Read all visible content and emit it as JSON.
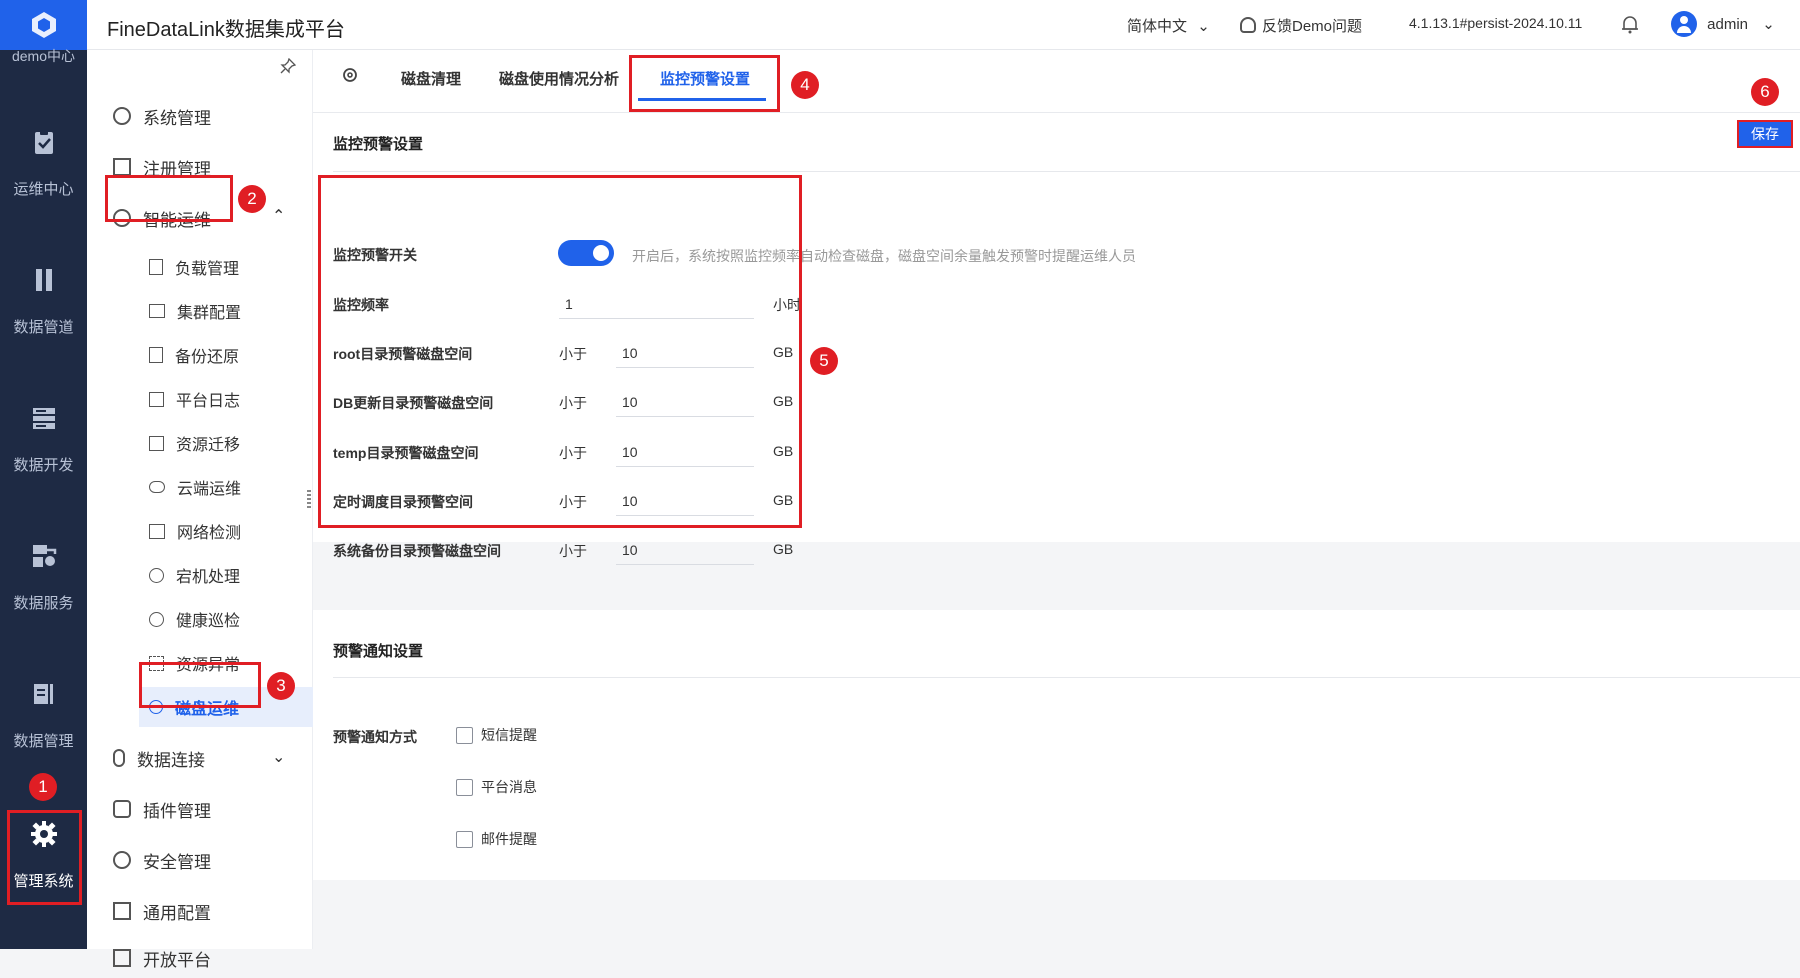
{
  "app": {
    "title": "FineDataLink数据集成平台"
  },
  "leftnav": {
    "top_label": "demo中心",
    "items": [
      {
        "label": "运维中心",
        "icon": "clipboard-check-icon"
      },
      {
        "label": "数据管道",
        "icon": "pipeline-icon"
      },
      {
        "label": "数据开发",
        "icon": "database-dev-icon"
      },
      {
        "label": "数据服务",
        "icon": "service-icon"
      },
      {
        "label": "数据管理",
        "icon": "data-manage-icon"
      },
      {
        "label": "管理系统",
        "icon": "gear-icon"
      }
    ]
  },
  "topbar": {
    "language": "简体中文",
    "feedback": "反馈Demo问题",
    "version": "4.1.13.1#persist-2024.10.11",
    "user": "admin"
  },
  "sidebar": {
    "items": [
      {
        "label": "系统管理"
      },
      {
        "label": "注册管理"
      },
      {
        "label": "智能运维"
      },
      {
        "label": "负载管理"
      },
      {
        "label": "集群配置"
      },
      {
        "label": "备份还原"
      },
      {
        "label": "平台日志"
      },
      {
        "label": "资源迁移"
      },
      {
        "label": "云端运维"
      },
      {
        "label": "网络检测"
      },
      {
        "label": "宕机处理"
      },
      {
        "label": "健康巡检"
      },
      {
        "label": "资源异常"
      },
      {
        "label": "磁盘运维"
      },
      {
        "label": "数据连接"
      },
      {
        "label": "插件管理"
      },
      {
        "label": "安全管理"
      },
      {
        "label": "通用配置"
      },
      {
        "label": "开放平台"
      }
    ]
  },
  "tabs": [
    {
      "label": "磁盘清理"
    },
    {
      "label": "磁盘使用情况分析"
    },
    {
      "label": "监控预警设置"
    }
  ],
  "monitor": {
    "section_title": "监控预警设置",
    "save_label": "保存",
    "switch_label": "监控预警开关",
    "switch_on": true,
    "switch_desc": "开启后，系统按照监控频率自动检查磁盘，磁盘空间余量触发预警时提醒运维人员",
    "rows": [
      {
        "label": "监控频率",
        "less": "",
        "value": "1",
        "unit": "小时"
      },
      {
        "label": "root目录预警磁盘空间",
        "less": "小于",
        "value": "10",
        "unit": "GB"
      },
      {
        "label": "DB更新目录预警磁盘空间",
        "less": "小于",
        "value": "10",
        "unit": "GB"
      },
      {
        "label": "temp目录预警磁盘空间",
        "less": "小于",
        "value": "10",
        "unit": "GB"
      },
      {
        "label": "定时调度目录预警空间",
        "less": "小于",
        "value": "10",
        "unit": "GB"
      },
      {
        "label": "系统备份目录预警磁盘空间",
        "less": "小于",
        "value": "10",
        "unit": "GB"
      }
    ]
  },
  "notify": {
    "section_title": "预警通知设置",
    "method_label": "预警通知方式",
    "options": [
      {
        "label": "短信提醒"
      },
      {
        "label": "平台消息"
      },
      {
        "label": "邮件提醒"
      }
    ]
  },
  "badges": [
    "1",
    "2",
    "3",
    "4",
    "5",
    "6"
  ],
  "colors": {
    "accent": "#2062ea",
    "nav_bg": "#1e2a44",
    "annotation": "#e01e24"
  }
}
